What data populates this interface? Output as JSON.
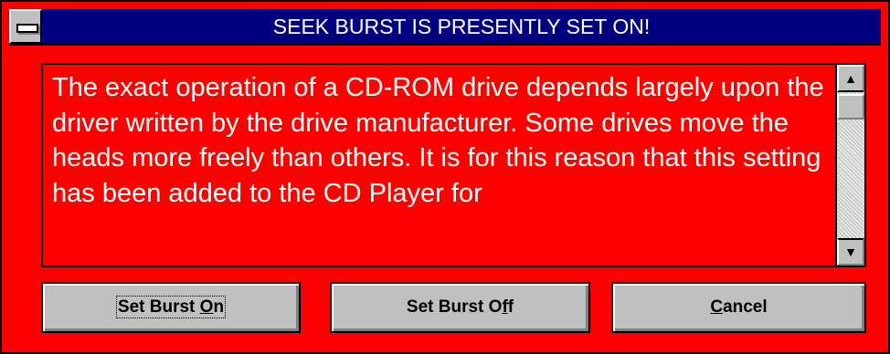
{
  "window": {
    "title": "SEEK BURST IS PRESENTLY SET ON!",
    "system_menu_icon": "system-menu-icon"
  },
  "message": {
    "text": "The exact operation of a CD-ROM drive depends largely upon the driver written by the drive manufacturer.  Some drives move the heads more freely than others.  It is for this reason that this setting has been added to the CD Player for"
  },
  "scrollbar": {
    "up_icon": "scroll-up-arrow-icon",
    "down_icon": "scroll-down-arrow-icon",
    "up_glyph": "▲",
    "down_glyph": "▼"
  },
  "buttons": {
    "set_on": {
      "before": "Set Burst ",
      "mnemonic": "O",
      "after": "n"
    },
    "set_off": {
      "before": "Set Burst O",
      "mnemonic": "f",
      "after": "f"
    },
    "cancel": {
      "before": "",
      "mnemonic": "C",
      "after": "ancel"
    }
  },
  "colors": {
    "dialog_background": "#ff0000",
    "titlebar": "#000080",
    "button_face": "#c0c0c0",
    "text": "#ffffff"
  }
}
